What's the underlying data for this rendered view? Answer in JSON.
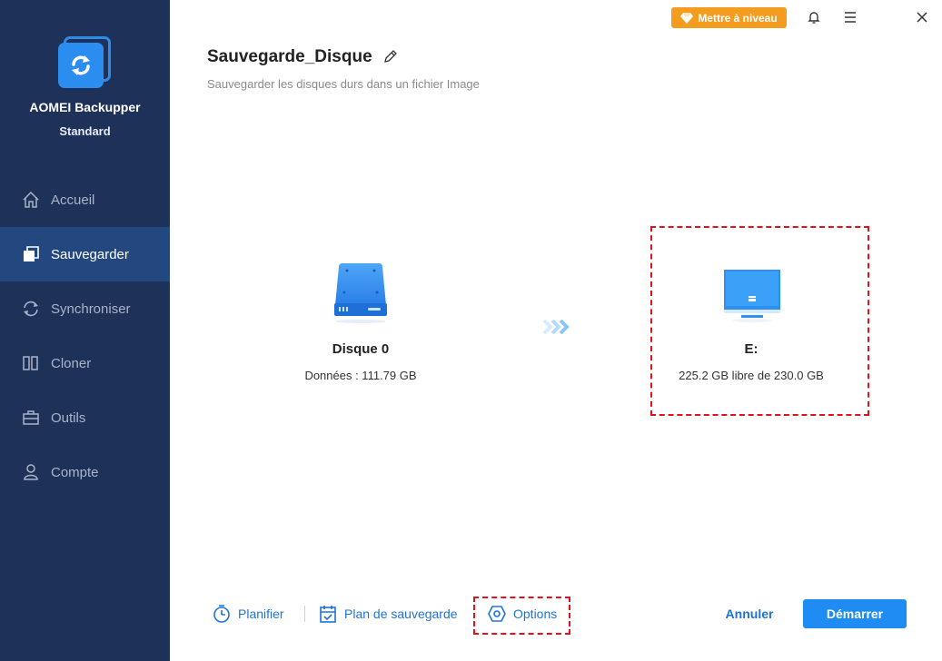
{
  "app": {
    "name": "AOMEI Backupper",
    "edition": "Standard"
  },
  "sidebar": {
    "items": [
      {
        "label": "Accueil",
        "icon": "home-icon",
        "active": false
      },
      {
        "label": "Sauvegarder",
        "icon": "backup-icon",
        "active": true
      },
      {
        "label": "Synchroniser",
        "icon": "sync-icon",
        "active": false
      },
      {
        "label": "Cloner",
        "icon": "clone-icon",
        "active": false
      },
      {
        "label": "Outils",
        "icon": "toolbox-icon",
        "active": false
      },
      {
        "label": "Compte",
        "icon": "user-icon",
        "active": false
      }
    ]
  },
  "topbar": {
    "upgrade_label": "Mettre à niveau",
    "icons": [
      "bell-icon",
      "menu-icon",
      "close-icon"
    ]
  },
  "header": {
    "title": "Sauvegarde_Disque",
    "subtitle": "Sauvegarder les disques durs dans un fichier Image"
  },
  "source": {
    "name": "Disque 0",
    "detail": "Données : 111.79 GB"
  },
  "destination": {
    "name": "E:",
    "detail": "225.2 GB libre de 230.0 GB"
  },
  "footer": {
    "schedule_label": "Planifier",
    "backup_scheme_label": "Plan de sauvegarde",
    "options_label": "Options",
    "cancel_label": "Annuler",
    "start_label": "Démarrer"
  },
  "colors": {
    "sidebar_bg": "#1e3159",
    "sidebar_active": "#23487f",
    "accent": "#1e8cf2",
    "upgrade": "#f39c1e",
    "highlight_dash": "#e3111a"
  }
}
